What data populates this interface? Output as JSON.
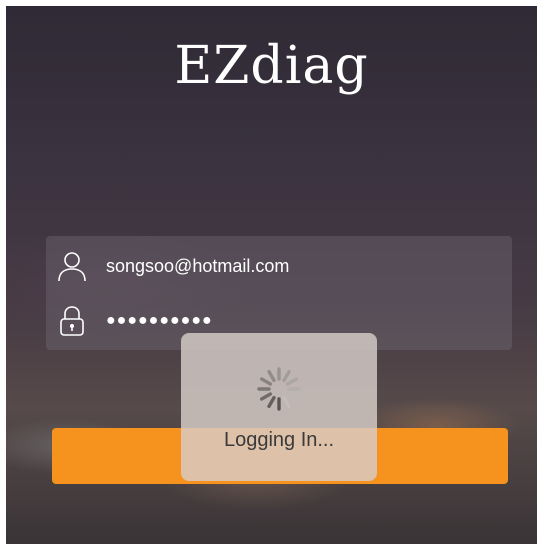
{
  "app": {
    "title": "EZdiag"
  },
  "login_form": {
    "username_value": "songsoo@hotmail.com",
    "password_masked": "●●●●●●●●●●",
    "user_icon": "user-icon",
    "lock_icon": "lock-icon"
  },
  "login_button": {
    "label": ""
  },
  "progress_hud": {
    "text": "Logging In...",
    "icon": "spinner-icon"
  },
  "colors": {
    "accent": "#f6921e",
    "hud_bg": "#d7cdc8"
  }
}
